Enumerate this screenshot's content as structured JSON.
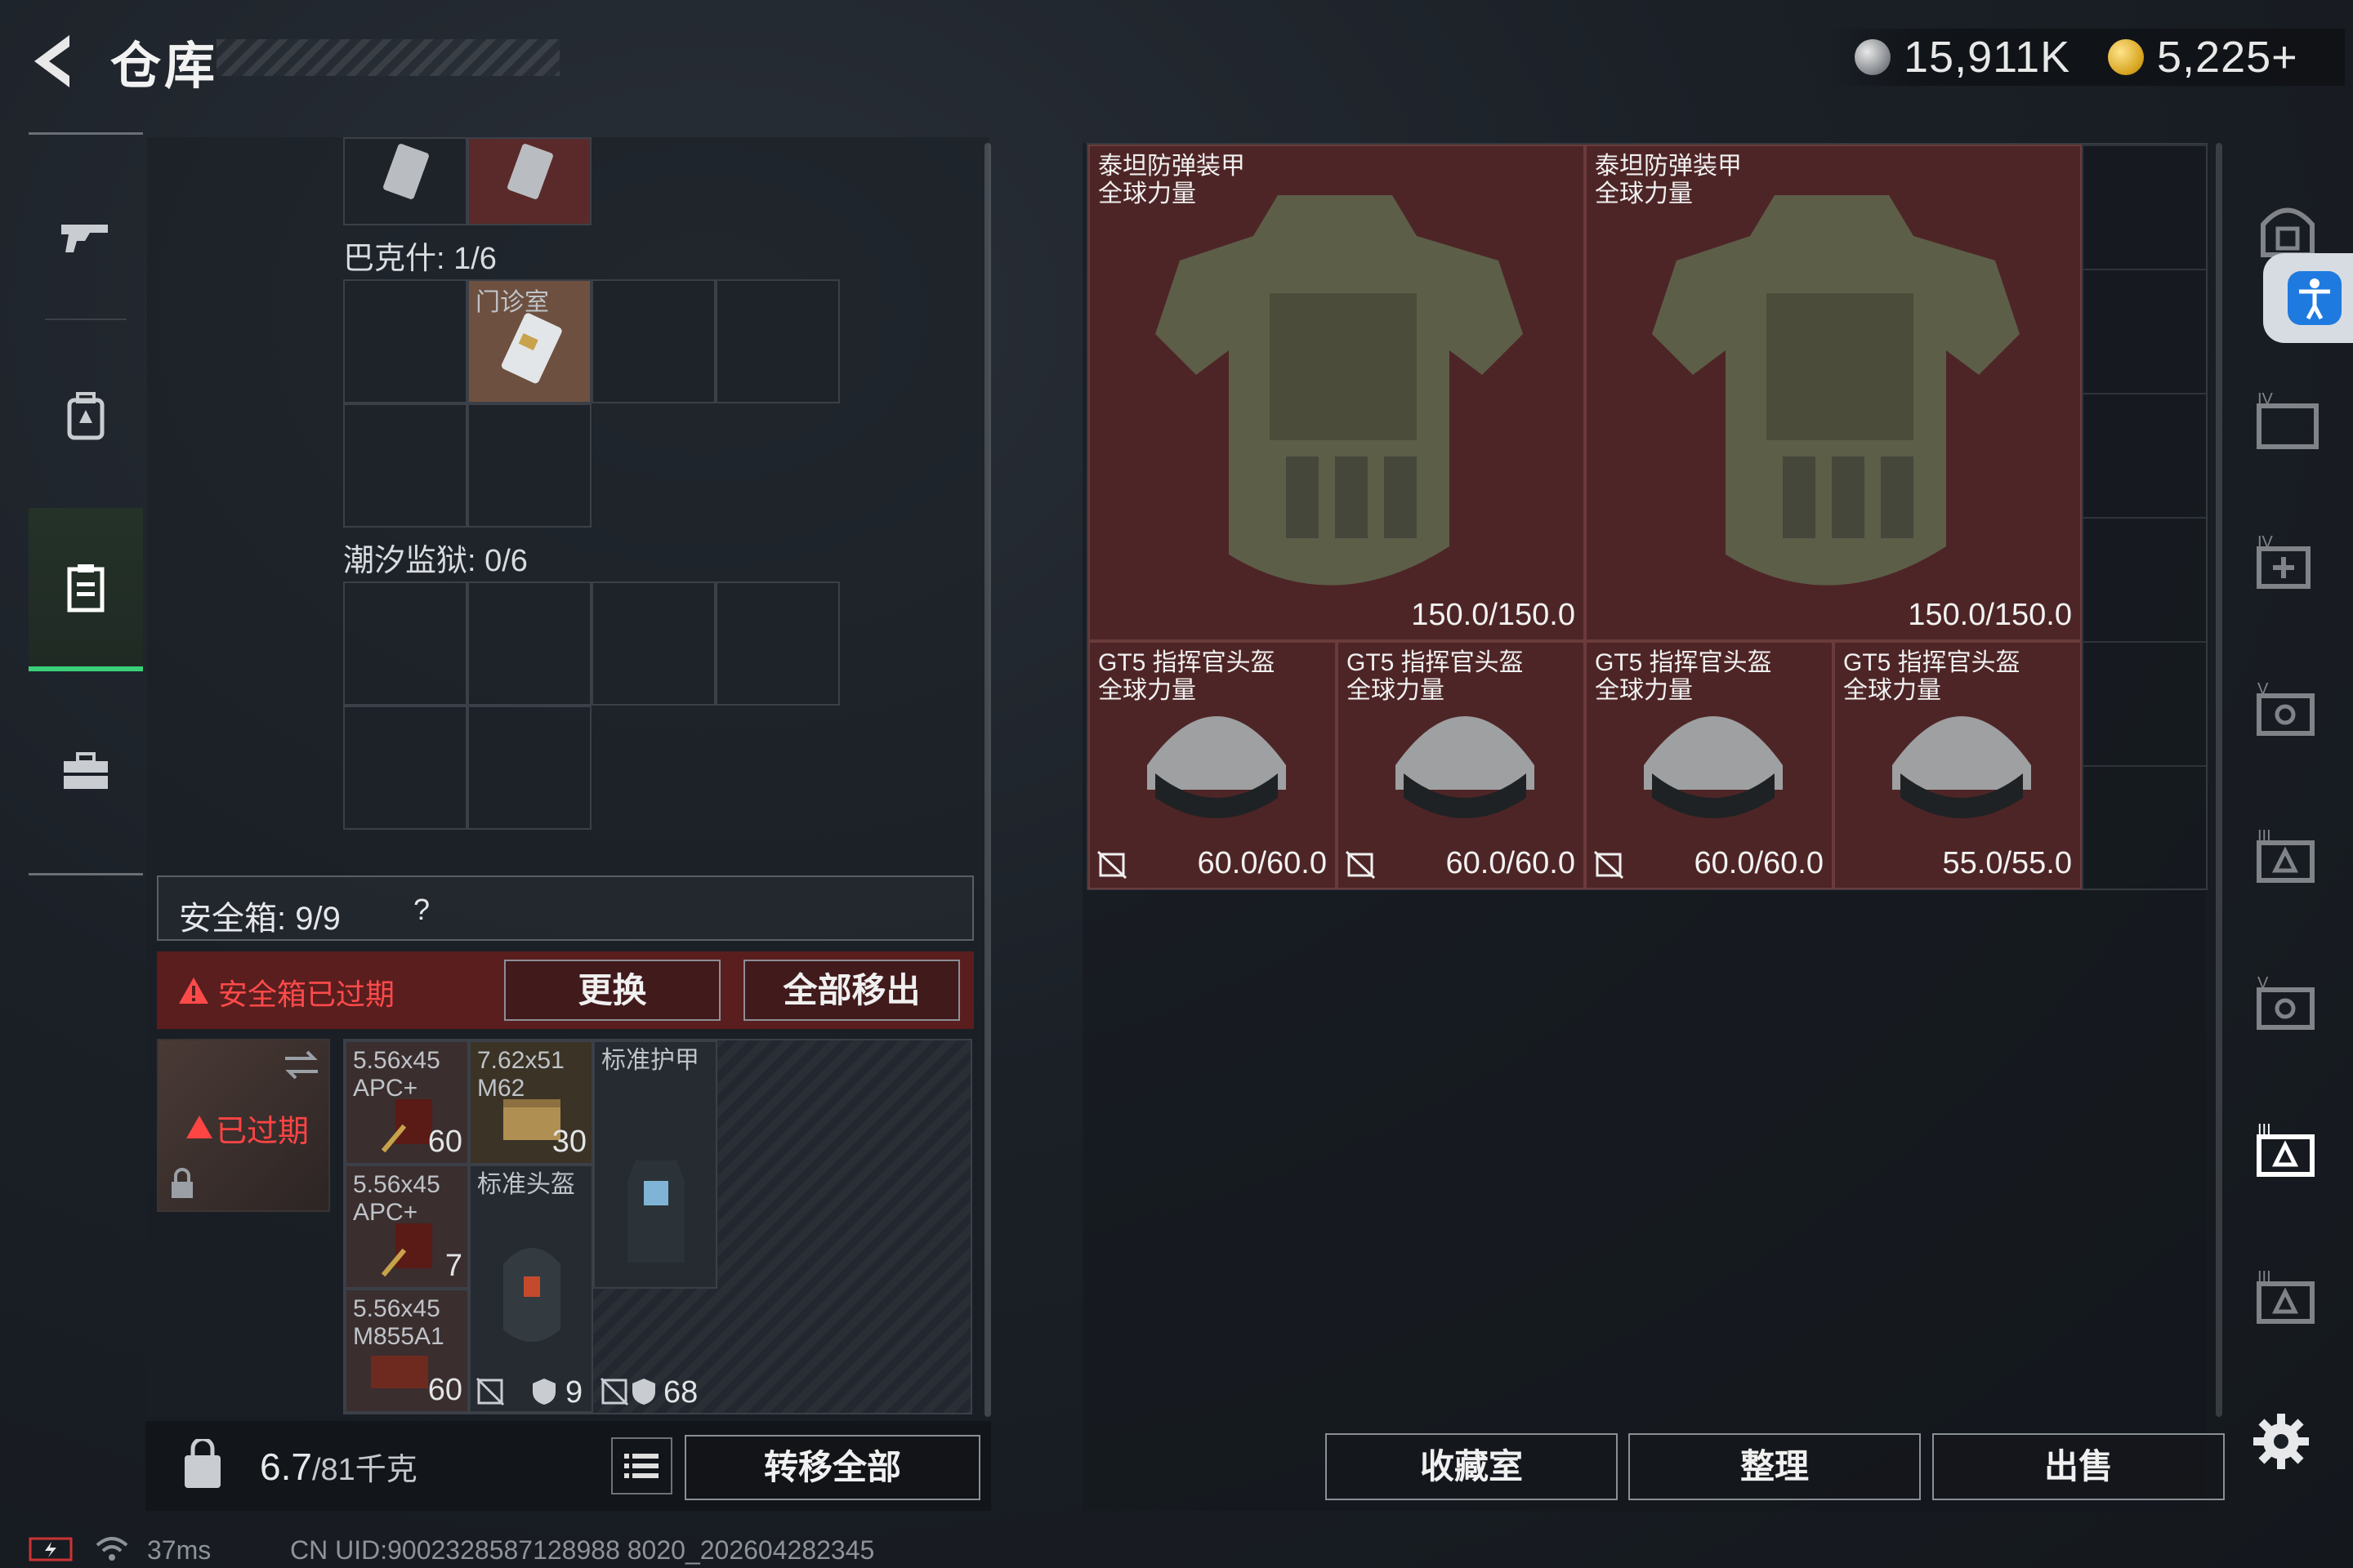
{
  "header": {
    "title": "仓库",
    "currency": {
      "silver": "15,911K",
      "gold": "5,225",
      "gold_add": "+"
    }
  },
  "left_panel": {
    "sections": [
      {
        "label": "巴克什: 1/6"
      },
      {
        "label": "潮汐监狱: 0/6"
      }
    ],
    "clinic_key_label": "门诊室"
  },
  "safebox": {
    "label": "安全箱: 9/9",
    "help": "?",
    "expired_warning": "安全箱已过期",
    "replace_label": "更换",
    "move_all_label": "全部移出",
    "expired_tag": "已过期",
    "items": [
      {
        "name": "5.56x45\nAPC+",
        "count": "60"
      },
      {
        "name": "7.62x51\nM62",
        "count": "30"
      },
      {
        "name": "标准护甲",
        "count": ""
      },
      {
        "name": "5.56x45\nAPC+",
        "count": "7"
      },
      {
        "name": "标准头盔",
        "count": ""
      },
      {
        "name": "5.56x45\nM855A1",
        "count": "60"
      }
    ],
    "durability_a": "9",
    "durability_b": "68"
  },
  "footer_left": {
    "weight_current": "6.7",
    "weight_max": "/81千克",
    "transfer_all_label": "转移全部"
  },
  "status": {
    "ping": "37ms",
    "uid": "CN UID:9002328587128988 8020_202604282345"
  },
  "storage": {
    "armor": [
      {
        "name": "泰坦防弹装甲\n全球力量",
        "durability": "150.0/150.0"
      },
      {
        "name": "泰坦防弹装甲\n全球力量",
        "durability": "150.0/150.0"
      }
    ],
    "helmets": [
      {
        "name": "GT5 指挥官头盔\n全球力量",
        "durability": "60.0/60.0"
      },
      {
        "name": "GT5 指挥官头盔\n全球力量",
        "durability": "60.0/60.0"
      },
      {
        "name": "GT5 指挥官头盔\n全球力量",
        "durability": "60.0/60.0"
      },
      {
        "name": "GT5 指挥官头盔\n全球力量",
        "durability": "55.0/55.0"
      }
    ]
  },
  "footer_right": {
    "collection_label": "收藏室",
    "tidy_label": "整理",
    "sell_label": "出售"
  },
  "colors": {
    "accent_green": "#3ad17a",
    "item_red": "#4e2526",
    "warning_red": "#ff4a4a"
  }
}
